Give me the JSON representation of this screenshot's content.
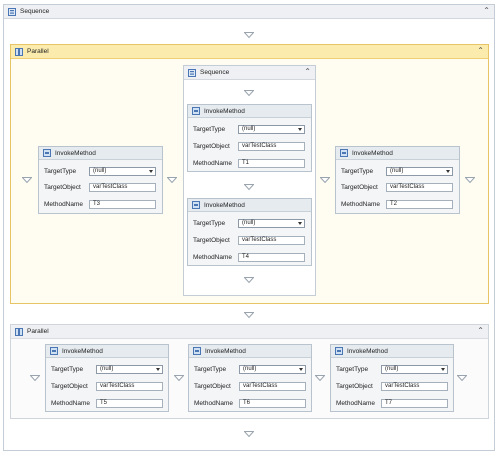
{
  "sequence_outer": {
    "title": "Sequence"
  },
  "parallel1": {
    "title": "Parallel"
  },
  "sequence_inner": {
    "title": "Sequence"
  },
  "parallel2": {
    "title": "Parallel"
  },
  "labels": {
    "target_type": "TargetType",
    "target_object": "TargetObject",
    "method_name": "MethodName"
  },
  "activities": {
    "t3": {
      "title": "InvokeMethod",
      "target_type": "(null)",
      "target_object": "varTestClass",
      "method_name": "T3"
    },
    "t1": {
      "title": "InvokeMethod",
      "target_type": "(null)",
      "target_object": "varTestClass",
      "method_name": "T1"
    },
    "t4": {
      "title": "InvokeMethod",
      "target_type": "(null)",
      "target_object": "varTestClass",
      "method_name": "T4"
    },
    "t2": {
      "title": "InvokeMethod",
      "target_type": "(null)",
      "target_object": "varTestClass",
      "method_name": "T2"
    },
    "t5": {
      "title": "InvokeMethod",
      "target_type": "(null)",
      "target_object": "varTestClass",
      "method_name": "T5"
    },
    "t6": {
      "title": "InvokeMethod",
      "target_type": "(null)",
      "target_object": "varTestClass",
      "method_name": "T6"
    },
    "t7": {
      "title": "InvokeMethod",
      "target_type": "(null)",
      "target_object": "varTestClass",
      "method_name": "T7"
    }
  },
  "icons": {
    "sequence": "sequence-icon",
    "parallel": "parallel-icon",
    "invoke": "invoke-method-icon",
    "collapse": "collapse-icon",
    "drop": "drop-target-triangle"
  },
  "colors": {
    "parallel_yellow_header": "#fbecae",
    "parallel_yellow_border": "#e7c567",
    "header_gray": "#eef0f3"
  }
}
